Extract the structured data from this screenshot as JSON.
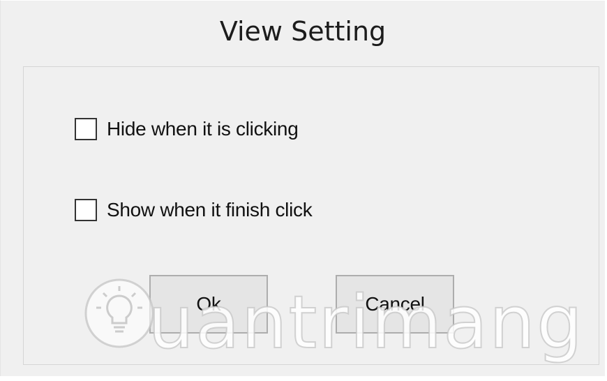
{
  "dialog": {
    "title": "View Setting",
    "options": [
      {
        "label": "Hide when it is clicking",
        "checked": false
      },
      {
        "label": "Show when it finish click",
        "checked": false
      }
    ],
    "buttons": {
      "ok_label": "Ok",
      "cancel_label": "Cancel"
    }
  },
  "watermark": {
    "brand_text": "uantrimang",
    "icon": "lightbulb-icon"
  },
  "colors": {
    "background": "#f0f0f0",
    "button_face": "#e5e5e5",
    "button_border": "#adadad",
    "checkbox_border": "#333333",
    "group_border": "#d5d5d5"
  }
}
